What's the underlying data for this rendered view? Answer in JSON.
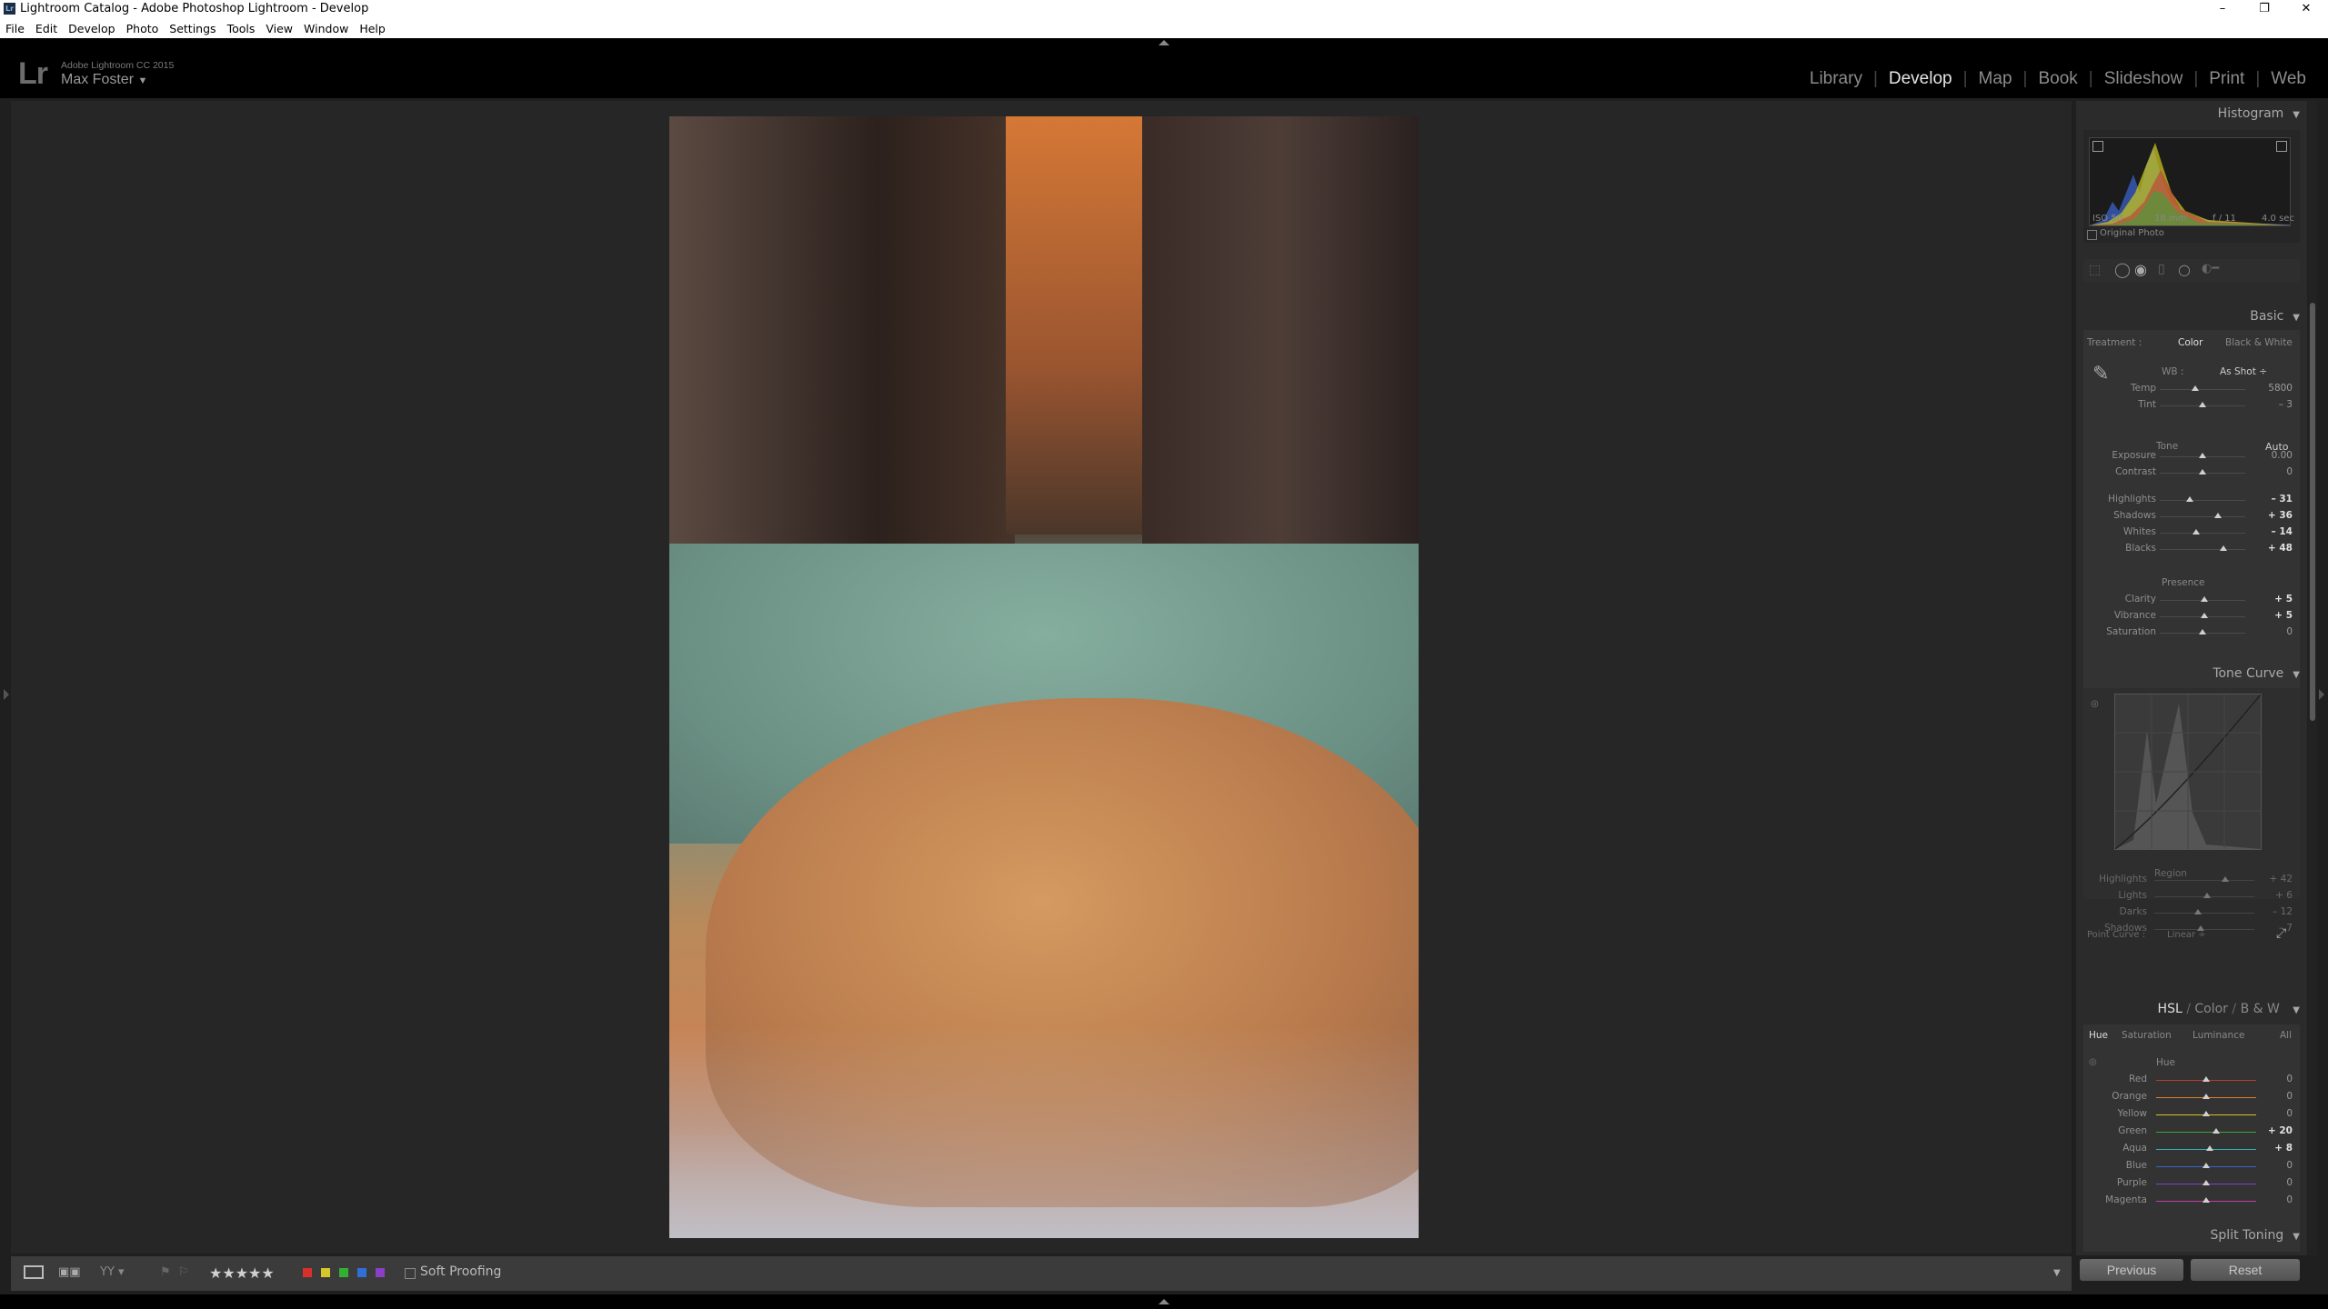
{
  "window": {
    "title": "Lightroom Catalog - Adobe Photoshop Lightroom - Develop",
    "controls": {
      "minimize": "–",
      "maximize": "❐",
      "close": "✕"
    }
  },
  "menu": [
    "File",
    "Edit",
    "Develop",
    "Photo",
    "Settings",
    "Tools",
    "View",
    "Window",
    "Help"
  ],
  "identity": {
    "logo": "Lr",
    "app_name": "Adobe Lightroom CC 2015",
    "user": "Max Foster",
    "user_caret": "▼"
  },
  "modules": [
    {
      "label": "Library",
      "active": false
    },
    {
      "label": "Develop",
      "active": true
    },
    {
      "label": "Map",
      "active": false
    },
    {
      "label": "Book",
      "active": false
    },
    {
      "label": "Slideshow",
      "active": false
    },
    {
      "label": "Print",
      "active": false
    },
    {
      "label": "Web",
      "active": false
    }
  ],
  "histogram": {
    "title": "Histogram",
    "iso": "ISO 50",
    "focal": "18 mm",
    "aperture": "f / 11",
    "shutter": "4.0 sec",
    "original_photo": "Original Photo"
  },
  "basic": {
    "title": "Basic",
    "treatment_label": "Treatment :",
    "treatment_color": "Color",
    "treatment_bw": "Black & White",
    "wb_label": "WB :",
    "wb_value": "As Shot ÷",
    "tone_label": "Tone",
    "auto_label": "Auto",
    "presence_label": "Presence",
    "sliders": [
      {
        "label": "Temp",
        "value": "5800",
        "pos": 0.42,
        "bold": false
      },
      {
        "label": "Tint",
        "value": "– 3",
        "pos": 0.5,
        "bold": false
      },
      {
        "label": "Exposure",
        "value": "0.00",
        "pos": 0.5,
        "bold": false
      },
      {
        "label": "Contrast",
        "value": "0",
        "pos": 0.5,
        "bold": false
      },
      {
        "label": "Highlights",
        "value": "– 31",
        "pos": 0.35,
        "bold": true
      },
      {
        "label": "Shadows",
        "value": "+ 36",
        "pos": 0.68,
        "bold": true
      },
      {
        "label": "Whites",
        "value": "– 14",
        "pos": 0.43,
        "bold": true
      },
      {
        "label": "Blacks",
        "value": "+ 48",
        "pos": 0.74,
        "bold": true
      },
      {
        "label": "Clarity",
        "value": "+ 5",
        "pos": 0.52,
        "bold": true
      },
      {
        "label": "Vibrance",
        "value": "+ 5",
        "pos": 0.52,
        "bold": true
      },
      {
        "label": "Saturation",
        "value": "0",
        "pos": 0.5,
        "bold": false
      }
    ]
  },
  "tone_curve": {
    "title": "Tone Curve",
    "region_label": "Region",
    "sliders": [
      {
        "label": "Highlights",
        "value": "+ 42",
        "pos": 0.71
      },
      {
        "label": "Lights",
        "value": "+ 6",
        "pos": 0.53
      },
      {
        "label": "Darks",
        "value": "– 12",
        "pos": 0.44
      },
      {
        "label": "Shadows",
        "value": "– 7",
        "pos": 0.46
      }
    ],
    "point_curve_label": "Point Curve :",
    "point_curve_value": "Linear ÷"
  },
  "hsl": {
    "title_hsl": "HSL",
    "title_color": "Color",
    "title_bw": "B & W",
    "tabs": [
      "Hue",
      "Saturation",
      "Luminance",
      "All"
    ],
    "group_label": "Hue",
    "sliders": [
      {
        "label": "Red",
        "value": "0",
        "pos": 0.5,
        "bold": false,
        "color": "#c0392b"
      },
      {
        "label": "Orange",
        "value": "0",
        "pos": 0.5,
        "bold": false,
        "color": "#d9822b"
      },
      {
        "label": "Yellow",
        "value": "0",
        "pos": 0.5,
        "bold": false,
        "color": "#d4c21e"
      },
      {
        "label": "Green",
        "value": "+ 20",
        "pos": 0.6,
        "bold": true,
        "color": "#3ea23e"
      },
      {
        "label": "Aqua",
        "value": "+ 8",
        "pos": 0.54,
        "bold": true,
        "color": "#2fb3b3"
      },
      {
        "label": "Blue",
        "value": "0",
        "pos": 0.5,
        "bold": false,
        "color": "#3565c9"
      },
      {
        "label": "Purple",
        "value": "0",
        "pos": 0.5,
        "bold": false,
        "color": "#8a3fc2"
      },
      {
        "label": "Magenta",
        "value": "0",
        "pos": 0.5,
        "bold": false,
        "color": "#c23ea4"
      }
    ]
  },
  "split_toning": {
    "title": "Split Toning"
  },
  "buttons": {
    "previous": "Previous",
    "reset": "Reset"
  },
  "toolbar": {
    "stars": "★★★★★",
    "soft_proofing": "Soft Proofing",
    "labels": [
      "#d9302b",
      "#d6c72a",
      "#33b033",
      "#2f6fd6",
      "#8b3fc7"
    ]
  }
}
